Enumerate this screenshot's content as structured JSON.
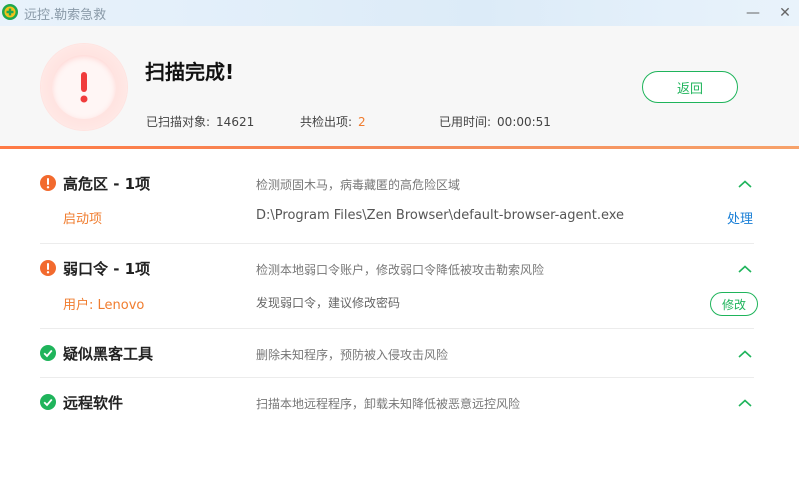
{
  "window": {
    "title": "远控.勒索急救",
    "minimize_symbol": "—",
    "close_symbol": "✕"
  },
  "header": {
    "title": "扫描完成!",
    "stats": {
      "scanned_label": "已扫描对象:",
      "scanned_value": "14621",
      "found_label": "共检出项:",
      "found_value": "2",
      "time_label": "已用时间:",
      "time_value": "00:00:51"
    },
    "back_label": "返回",
    "icon": "alert-exclamation-icon"
  },
  "sections": [
    {
      "title": "高危区 - 1项",
      "status": "warning",
      "description": "检测顽固木马，病毒藏匿的高危险区域",
      "item_label": "启动项",
      "item_detail": "D:\\Program Files\\Zen Browser\\default-browser-agent.exe",
      "action": "处理"
    },
    {
      "title": "弱口令 - 1项",
      "status": "warning",
      "description": "检测本地弱口令账户，修改弱口令降低被攻击勒索风险",
      "item_label": "用户: Lenovo",
      "item_detail": "发现弱口令，建议修改密码",
      "action": "修改"
    },
    {
      "title": "疑似黑客工具",
      "status": "ok",
      "description": "删除未知程序，预防被入侵攻击风险"
    },
    {
      "title": "远程软件",
      "status": "ok",
      "description": "扫描本地远程程序，卸载未知降低被恶意远控风险"
    }
  ],
  "colors": {
    "accent_green": "#1fb45b",
    "warning_orange": "#f07c2e",
    "link_blue": "#1a7fd6",
    "alert_red": "#f03c3c"
  }
}
